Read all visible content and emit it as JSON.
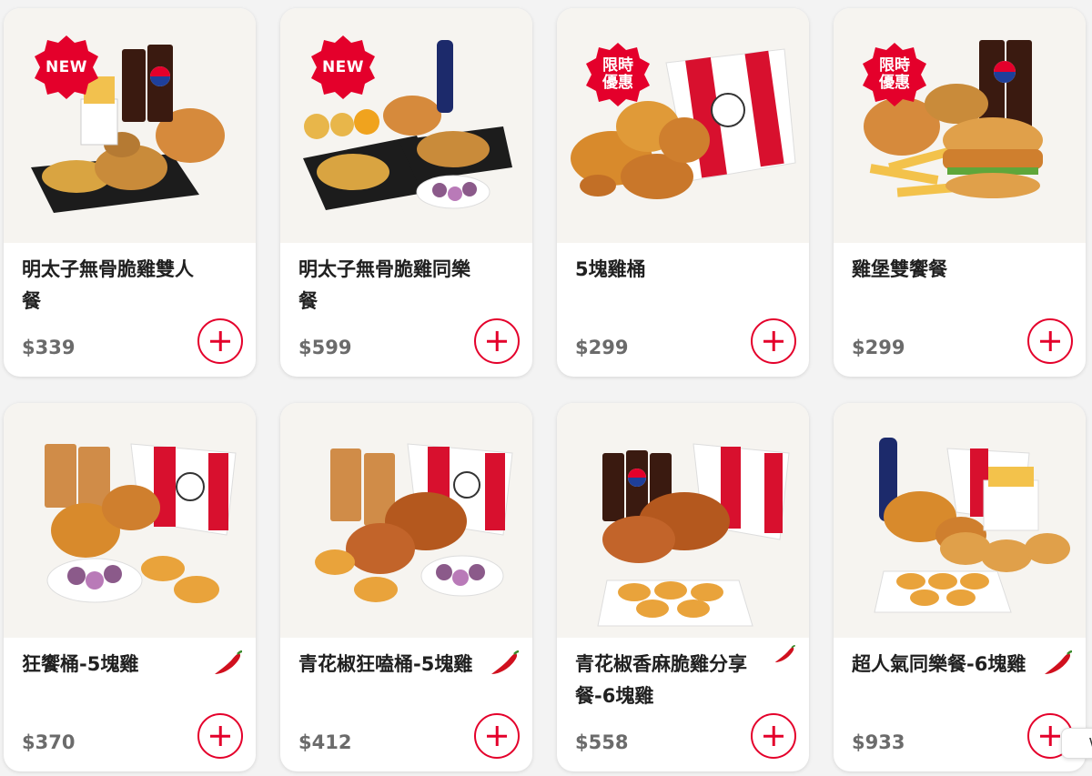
{
  "products": [
    {
      "name": "明太子無骨脆雞雙人餐",
      "price": "$339",
      "badge": "NEW",
      "spicy": false,
      "image": "mentaiko-duo-meal",
      "add_icon": "plus-icon"
    },
    {
      "name": "明太子無骨脆雞同樂餐",
      "price": "$599",
      "badge": "NEW",
      "spicy": false,
      "image": "mentaiko-party-meal",
      "add_icon": "plus-icon"
    },
    {
      "name": "5塊雞桶",
      "price": "$299",
      "badge": "限時\n優惠",
      "spicy": false,
      "image": "5pc-bucket",
      "add_icon": "plus-icon"
    },
    {
      "name": "雞堡雙饗餐",
      "price": "$299",
      "badge": "限時\n優惠",
      "spicy": false,
      "image": "burger-duo-meal",
      "add_icon": "plus-icon"
    },
    {
      "name": "狂饗桶-5塊雞",
      "price": "$370",
      "badge": "",
      "spicy": true,
      "image": "feast-bucket",
      "add_icon": "plus-icon"
    },
    {
      "name": "青花椒狂嗑桶-5塊雞",
      "price": "$412",
      "badge": "",
      "spicy": true,
      "image": "green-pepper-bucket",
      "add_icon": "plus-icon"
    },
    {
      "name": "青花椒香麻脆雞分享餐-6塊雞",
      "price": "$558",
      "badge": "",
      "spicy": true,
      "image": "green-pepper-share-meal",
      "add_icon": "plus-icon"
    },
    {
      "name": "超人氣同樂餐-6塊雞",
      "price": "$933",
      "badge": "",
      "spicy": true,
      "image": "popular-party-meal",
      "add_icon": "plus-icon"
    }
  ],
  "chat_widget": {
    "label": "We"
  },
  "colors": {
    "brand": "#e4002b",
    "price": "#6b6b6b",
    "text": "#202020"
  }
}
